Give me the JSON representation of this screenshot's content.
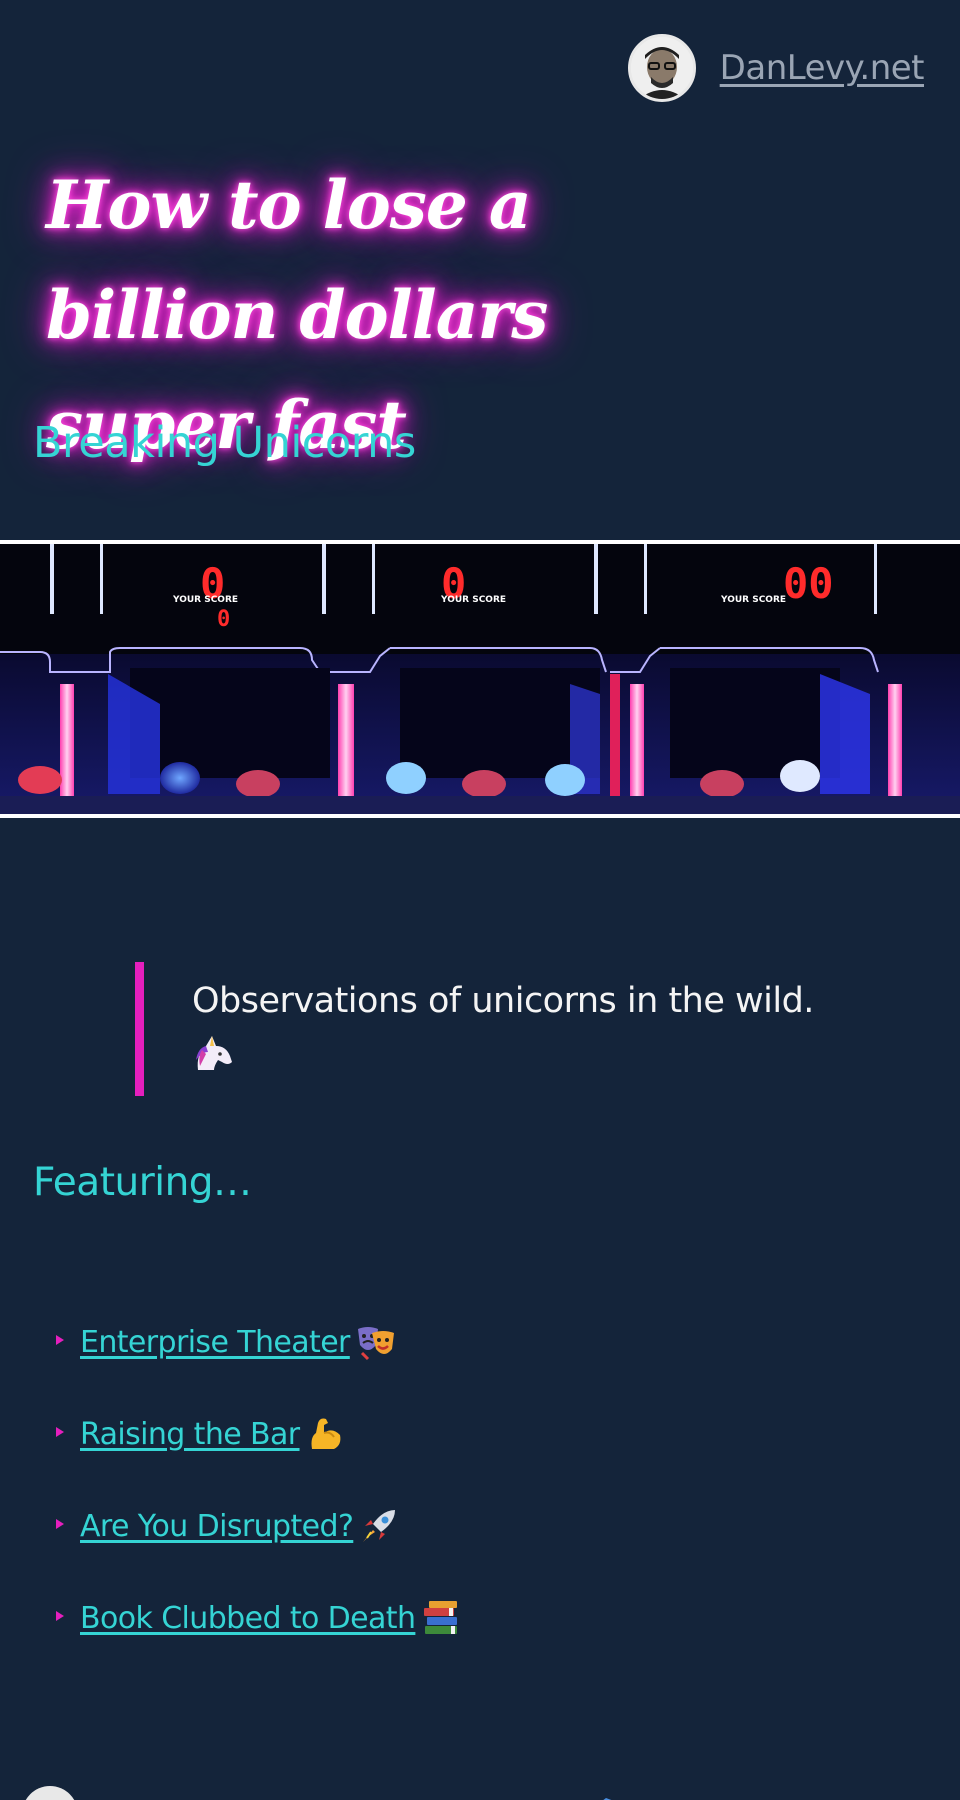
{
  "header": {
    "site_name": "DanLevy.net",
    "avatar_icon": "person-avatar-icon"
  },
  "article": {
    "title": "How to lose a billion dollars super fast",
    "series": "Breaking Unicorns",
    "title_glow_color": "#e21bd0",
    "accent_color": "#35d4d4"
  },
  "hero": {
    "scores": [
      "0",
      "0",
      "00"
    ],
    "score_sub": "0",
    "score_label": "YOUR SCORE"
  },
  "quote": {
    "text": "Observations of unicorns in the wild.",
    "emoji": "unicorn-icon",
    "border_color": "#e51fbd"
  },
  "featuring": {
    "heading": "Featuring…",
    "items": [
      {
        "label": "Enterprise Theater",
        "icon": "theater-masks-icon"
      },
      {
        "label": "Raising the Bar",
        "icon": "flexed-biceps-icon"
      },
      {
        "label": "Are You Disrupted?",
        "icon": "rocket-icon"
      },
      {
        "label": "Book Clubbed to Death",
        "icon": "books-icon"
      }
    ]
  }
}
